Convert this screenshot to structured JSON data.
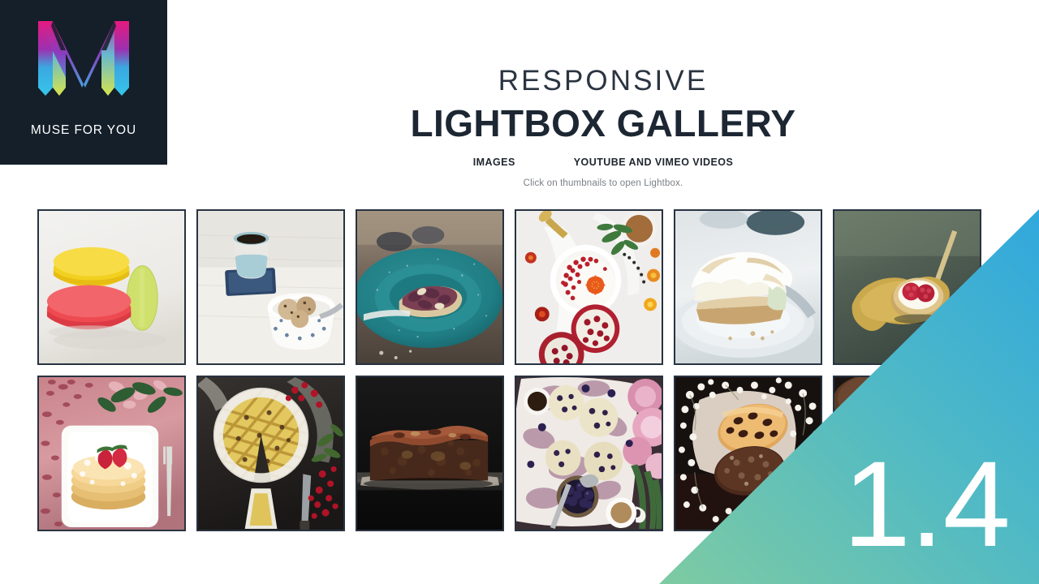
{
  "brand": {
    "logo_icon": "muse-m-logo-icon",
    "name": "MUSE FOR YOU",
    "panel_bg": "#141f2a",
    "logo_colors": {
      "magenta": "#e6197f",
      "purple": "#7b3fc4",
      "blue": "#29a9e1",
      "cyan": "#3dc8f0",
      "lime": "#c8e23a",
      "yellow_green": "#d4e34a"
    }
  },
  "header": {
    "eyebrow": "RESPONSIVE",
    "title": "LIGHTBOX GALLERY",
    "hint": "Click on thumbnails to open Lightbox.",
    "tabs": [
      {
        "label": "IMAGES",
        "active": true
      },
      {
        "label": "YOUTUBE AND VIMEO VIDEOS",
        "active": false
      }
    ],
    "title_color": "#1d2733",
    "hint_color": "#7a7f85"
  },
  "gallery": {
    "columns": 6,
    "rows": 2,
    "border_color": "#283341",
    "thumbnails": [
      {
        "alt": "Stacked yellow, red and green macarons on white surface",
        "icon": "macarons-thumbnail"
      },
      {
        "alt": "Blue espresso cup on coaster with bowl of cookies",
        "icon": "coffee-cookies-thumbnail"
      },
      {
        "alt": "Slice of fruit tart on a speckled teal plate",
        "icon": "teal-plate-tart-thumbnail"
      },
      {
        "alt": "Pomegranate yogurt bowl flatlay with herbs and flowers",
        "icon": "pomegranate-bowl-thumbnail"
      },
      {
        "alt": "Slice of lemon meringue pie on a white plate",
        "icon": "meringue-pie-thumbnail"
      },
      {
        "alt": "Raspberry tartlet served on a yellow leaf",
        "icon": "raspberry-tartlet-thumbnail"
      },
      {
        "alt": "Pancake stack with strawberries and powdered sugar on pink",
        "icon": "pancakes-thumbnail"
      },
      {
        "alt": "Lattice pie on dark slate with red currants",
        "icon": "lattice-pie-thumbnail"
      },
      {
        "alt": "Chocolate brownie loaf on a dark background",
        "icon": "brownie-loaf-thumbnail"
      },
      {
        "alt": "Blueberry scones flatlay with coffee and peonies",
        "icon": "blueberry-scones-thumbnail"
      },
      {
        "alt": "Cookies arranged with white baby's breath flowers",
        "icon": "cookies-flowers-thumbnail"
      },
      {
        "alt": "Dark pastry partially hidden behind overlay",
        "icon": "dark-pastry-thumbnail"
      }
    ]
  },
  "overlay": {
    "version": "1.4",
    "gradient_from": "#7ecba2",
    "gradient_to": "#31a8dd",
    "shape": "corner-triangle"
  }
}
